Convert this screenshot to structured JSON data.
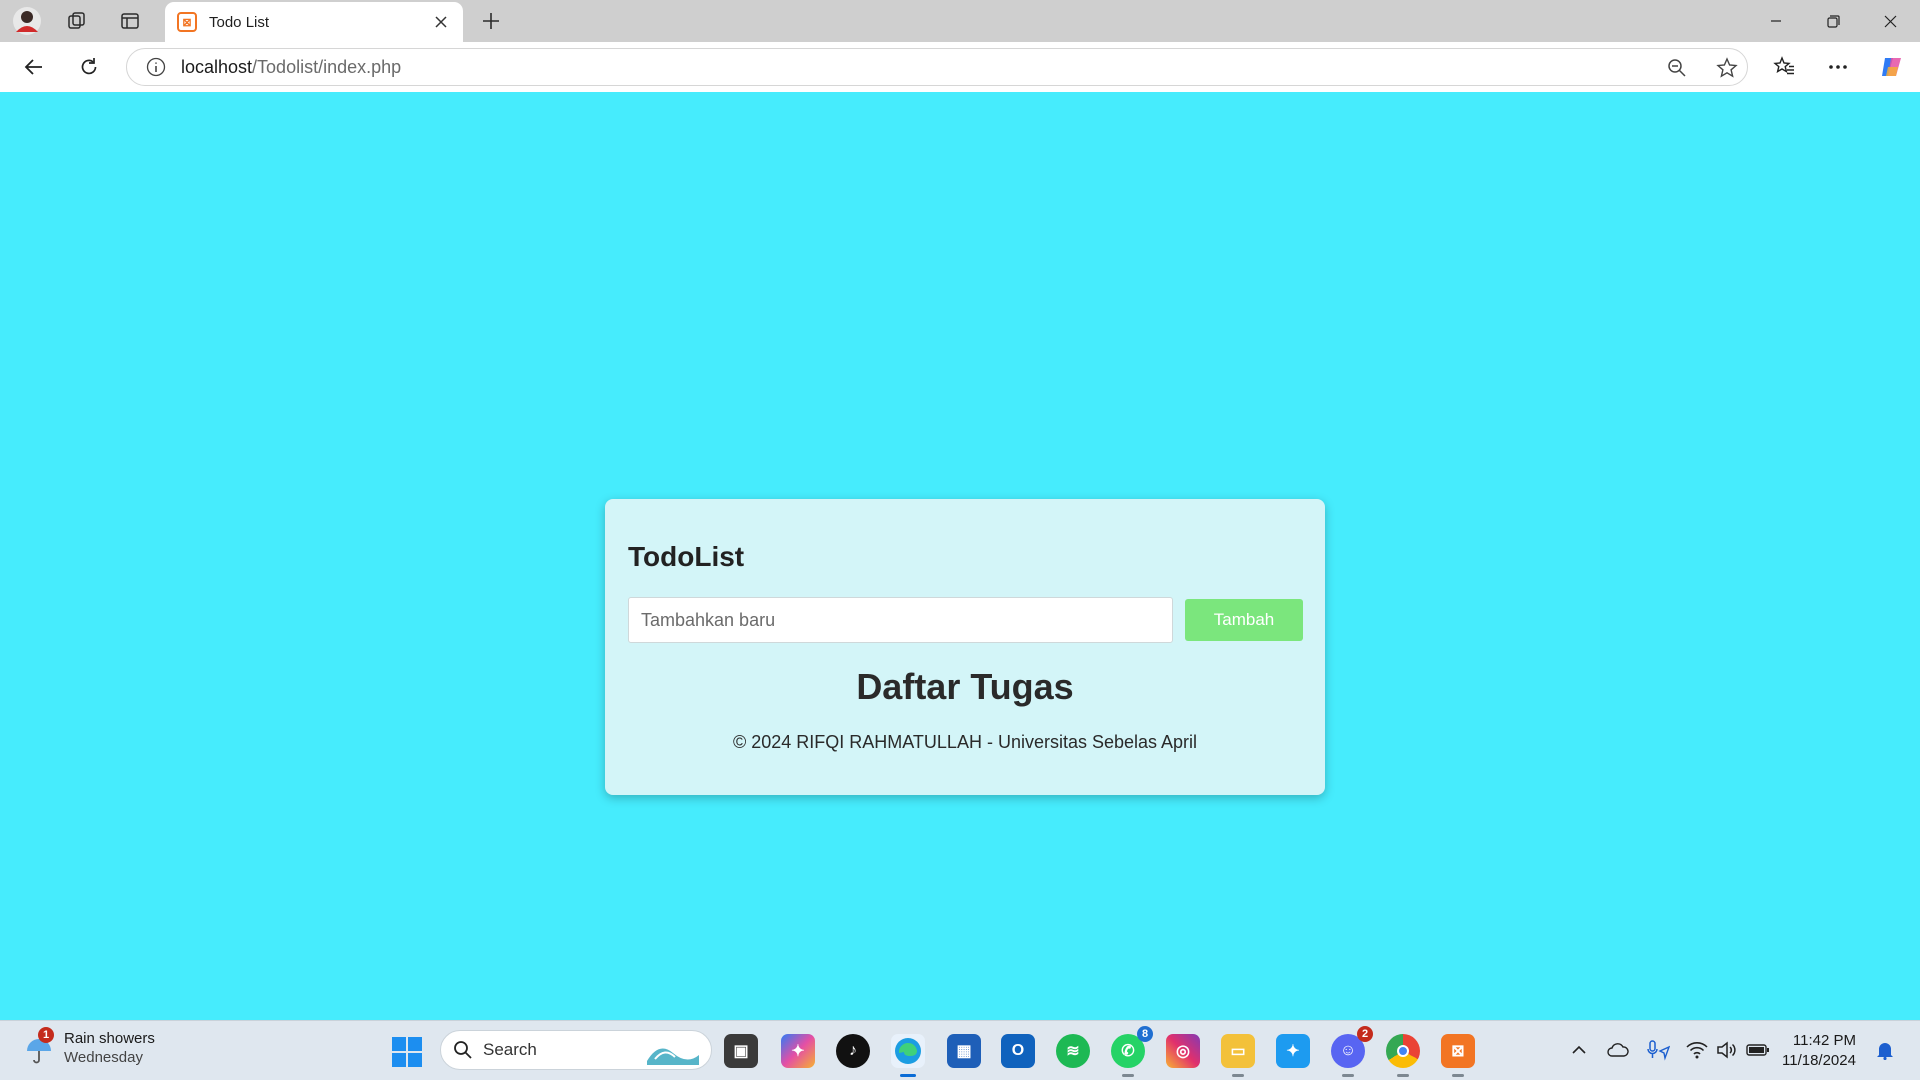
{
  "browser": {
    "tab_title": "Todo List",
    "url_host": "localhost",
    "url_path": "/Todolist/index.php"
  },
  "page": {
    "app_title": "TodoList",
    "input_placeholder": "Tambahkan baru",
    "add_button": "Tambah",
    "list_heading": "Daftar Tugas",
    "footer": "© 2024 RIFQI RAHMATULLAH - Universitas Sebelas April"
  },
  "taskbar": {
    "weather_condition": "Rain showers",
    "weather_day": "Wednesday",
    "weather_badge": "1",
    "search_label": "Search",
    "whatsapp_badge": "8",
    "discord_badge": "2",
    "time": "11:42 PM",
    "date": "11/18/2024"
  },
  "colors": {
    "page_background": "#46ecfd",
    "card_background": "#d3f5f8",
    "add_button": "#7be67d"
  }
}
